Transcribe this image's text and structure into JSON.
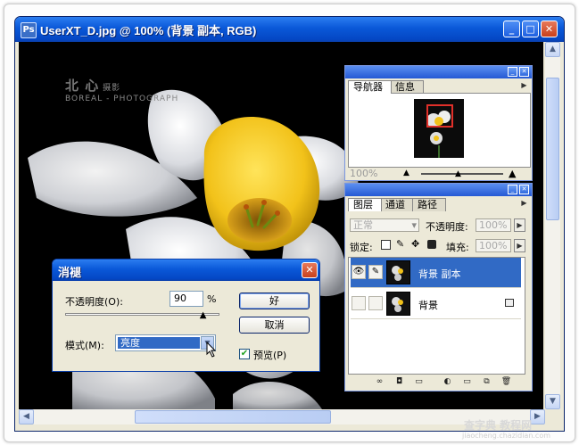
{
  "window": {
    "title": "UserXT_D.jpg @ 100% (背景 副本, RGB)",
    "icon": "photoshop-doc-icon",
    "controls": [
      "minimize",
      "maximize",
      "close"
    ]
  },
  "watermark": {
    "line1": "北 心",
    "line1b": "摄影",
    "line2": "BOREAL - PHOTOGRAPH"
  },
  "navigator_panel": {
    "tabs": [
      "导航器",
      "信息"
    ],
    "active_tab": 0,
    "zoom": "100%"
  },
  "layers_panel": {
    "tabs": [
      "图层",
      "通道",
      "路径"
    ],
    "active_tab": 0,
    "blend_mode": "正常",
    "opacity_label": "不透明度:",
    "opacity_value": "100%",
    "lock_label": "锁定:",
    "fill_label": "填充:",
    "fill_value": "100%",
    "layers": [
      {
        "name": "背景 副本",
        "selected": true,
        "visible": true,
        "locked": false
      },
      {
        "name": "背景",
        "selected": false,
        "visible": false,
        "locked": true
      }
    ]
  },
  "fade_dialog": {
    "title": "消褪",
    "opacity_label": "不透明度(O):",
    "opacity_value": "90",
    "opacity_unit": "%",
    "opacity_fraction": 0.9,
    "mode_label": "模式(M):",
    "mode_value": "亮度",
    "ok_label": "好",
    "cancel_label": "取消",
    "preview_label": "预览(P)",
    "preview_checked": true
  },
  "site_watermark": {
    "text": "查字典 教程网",
    "url": "jiaocheng.chazidian.com"
  },
  "colors": {
    "title_bar": "#0a58d8",
    "selection": "#316ac5",
    "flower_yellow": "#f2c21a",
    "petal_white": "#e8e8ea"
  }
}
